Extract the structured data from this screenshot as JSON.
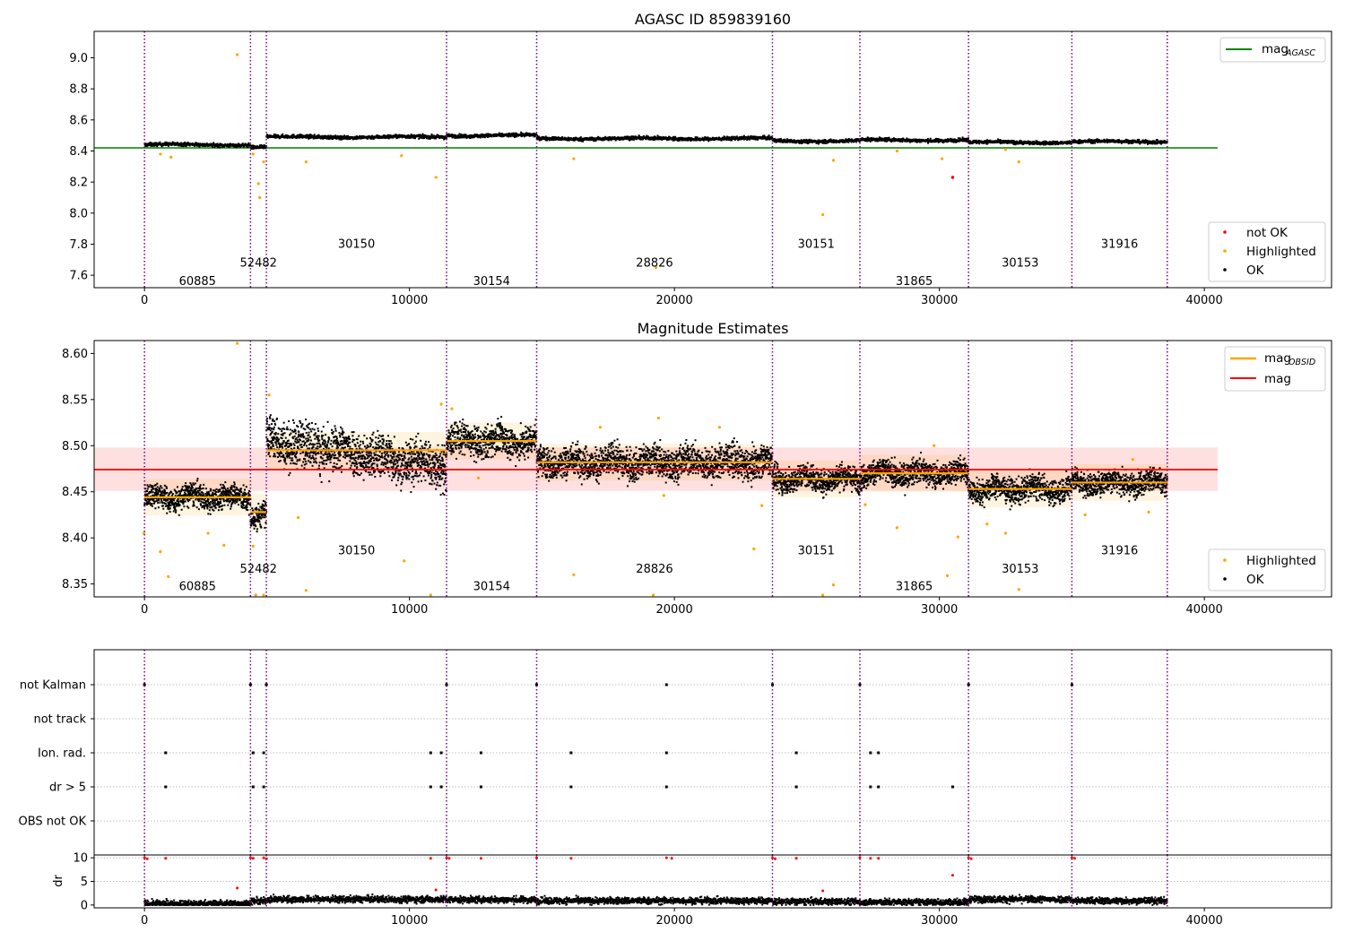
{
  "chart_data": [
    {
      "id": "p1",
      "type": "scatter",
      "title": "AGASC ID 859839160",
      "xlim": [
        -1900,
        44800
      ],
      "ylim": [
        7.52,
        9.17
      ],
      "xticks": [
        0,
        10000,
        20000,
        30000,
        40000
      ],
      "xtick_labels": [
        "0",
        "10000",
        "20000",
        "30000",
        "40000"
      ],
      "yticks": [
        7.6,
        7.8,
        8.0,
        8.2,
        8.4,
        8.6,
        8.8,
        9.0
      ],
      "ytick_labels": [
        "7.6",
        "7.8",
        "8.0",
        "8.2",
        "8.4",
        "8.6",
        "8.8",
        "9.0"
      ],
      "hline": {
        "name": "mag",
        "subscript": "AGASC",
        "y": 8.42,
        "x": [
          -1900,
          40500
        ],
        "color": "#008000"
      },
      "segments": [
        {
          "obsid": "60885",
          "x0": 0,
          "x1": 4000,
          "y": 8.44,
          "label_y": 7.56
        },
        {
          "obsid": "52482",
          "x0": 4000,
          "x1": 4600,
          "y": 8.425,
          "label_y": 7.68
        },
        {
          "obsid": "30150",
          "x0": 4600,
          "x1": 11400,
          "y": 8.49,
          "label_y": 7.8
        },
        {
          "obsid": "30154",
          "x0": 11400,
          "x1": 14800,
          "y": 8.5,
          "label_y": 7.56
        },
        {
          "obsid": "28826",
          "x0": 14800,
          "x1": 23700,
          "y": 8.48,
          "label_y": 7.68
        },
        {
          "obsid": "30151",
          "x0": 23700,
          "x1": 27000,
          "y": 8.465,
          "label_y": 7.8
        },
        {
          "obsid": "31865",
          "x0": 27000,
          "x1": 31100,
          "y": 8.47,
          "label_y": 7.56
        },
        {
          "obsid": "30153",
          "x0": 31100,
          "x1": 35000,
          "y": 8.455,
          "label_y": 7.68
        },
        {
          "obsid": "31916",
          "x0": 35000,
          "x1": 38600,
          "y": 8.46,
          "label_y": 7.8
        }
      ],
      "obs_boundaries": [
        0,
        4000,
        4600,
        11400,
        14800,
        23700,
        27000,
        31100,
        35000,
        38600
      ],
      "highlighted_points": [
        [
          3500,
          9.02
        ],
        [
          600,
          8.38
        ],
        [
          1000,
          8.36
        ],
        [
          4100,
          8.38
        ],
        [
          4300,
          8.19
        ],
        [
          4350,
          8.1
        ],
        [
          4500,
          8.33
        ],
        [
          6100,
          8.33
        ],
        [
          9700,
          8.37
        ],
        [
          11000,
          8.23
        ],
        [
          16200,
          8.35
        ],
        [
          19300,
          7.65
        ],
        [
          25600,
          7.99
        ],
        [
          26000,
          8.34
        ],
        [
          28400,
          8.4
        ],
        [
          30100,
          8.35
        ],
        [
          32500,
          8.41
        ],
        [
          33000,
          8.33
        ]
      ],
      "not_ok_points": [
        [
          30500,
          8.23
        ]
      ],
      "legend": [
        {
          "label": "mag",
          "subscript": "AGASC",
          "color": "#008000",
          "kind": "line"
        }
      ],
      "legend2": [
        {
          "label": "not OK",
          "color": "#ff0000",
          "kind": "dot"
        },
        {
          "label": "Highlighted",
          "color": "#ffa500",
          "kind": "dot"
        },
        {
          "label": "OK",
          "color": "#000000",
          "kind": "dot"
        }
      ]
    },
    {
      "id": "p2",
      "type": "scatter",
      "title": "Magnitude Estimates",
      "xlim": [
        -1900,
        44800
      ],
      "ylim": [
        8.336,
        8.614
      ],
      "xticks": [
        0,
        10000,
        20000,
        30000,
        40000
      ],
      "xtick_labels": [
        "0",
        "10000",
        "20000",
        "30000",
        "40000"
      ],
      "yticks": [
        8.35,
        8.4,
        8.45,
        8.5,
        8.55,
        8.6
      ],
      "ytick_labels": [
        "8.35",
        "8.40",
        "8.45",
        "8.50",
        "8.55",
        "8.60"
      ],
      "mag": {
        "name": "mag",
        "y": 8.474,
        "band": [
          8.451,
          8.498
        ],
        "x": [
          -1900,
          40500
        ],
        "color": "#ff0000"
      },
      "segments": [
        {
          "obsid": "60885",
          "x0": 0,
          "x1": 4000,
          "y": 8.444,
          "label_y": 8.347
        },
        {
          "obsid": "52482",
          "x0": 4000,
          "x1": 4600,
          "y": 8.428,
          "label_y": 8.366
        },
        {
          "obsid": "30150",
          "x0": 4600,
          "x1": 11400,
          "y": 8.495,
          "label_y": 8.386
        },
        {
          "obsid": "30154",
          "x0": 11400,
          "x1": 14800,
          "y": 8.505,
          "label_y": 8.347
        },
        {
          "obsid": "28826",
          "x0": 14800,
          "x1": 23700,
          "y": 8.482,
          "label_y": 8.366
        },
        {
          "obsid": "30151",
          "x0": 23700,
          "x1": 27000,
          "y": 8.464,
          "label_y": 8.386
        },
        {
          "obsid": "31865",
          "x0": 27000,
          "x1": 31100,
          "y": 8.47,
          "label_y": 8.347
        },
        {
          "obsid": "30153",
          "x0": 31100,
          "x1": 35000,
          "y": 8.453,
          "label_y": 8.366
        },
        {
          "obsid": "31916",
          "x0": 35000,
          "x1": 38600,
          "y": 8.46,
          "label_y": 8.386
        }
      ],
      "obs_boundaries": [
        0,
        4000,
        4600,
        11400,
        14800,
        23700,
        27000,
        31100,
        35000,
        38600
      ],
      "highlighted_points": [
        [
          3500,
          8.611
        ],
        [
          -20,
          8.405
        ],
        [
          600,
          8.385
        ],
        [
          900,
          8.358
        ],
        [
          2400,
          8.405
        ],
        [
          3000,
          8.392
        ],
        [
          4100,
          8.391
        ],
        [
          4200,
          8.338
        ],
        [
          4500,
          8.338
        ],
        [
          4700,
          8.555
        ],
        [
          5800,
          8.422
        ],
        [
          6100,
          8.343
        ],
        [
          9800,
          8.375
        ],
        [
          10800,
          8.338
        ],
        [
          11200,
          8.545
        ],
        [
          11600,
          8.54
        ],
        [
          12600,
          8.465
        ],
        [
          16200,
          8.36
        ],
        [
          17200,
          8.52
        ],
        [
          19200,
          8.338
        ],
        [
          19400,
          8.53
        ],
        [
          19600,
          8.446
        ],
        [
          21700,
          8.52
        ],
        [
          23000,
          8.388
        ],
        [
          23300,
          8.435
        ],
        [
          25600,
          8.338
        ],
        [
          26000,
          8.349
        ],
        [
          27200,
          8.436
        ],
        [
          28400,
          8.411
        ],
        [
          29800,
          8.5
        ],
        [
          30300,
          8.359
        ],
        [
          30700,
          8.401
        ],
        [
          31800,
          8.415
        ],
        [
          32500,
          8.405
        ],
        [
          33000,
          8.344
        ],
        [
          35500,
          8.425
        ],
        [
          37300,
          8.485
        ],
        [
          37900,
          8.428
        ]
      ],
      "legend": [
        {
          "label": "mag",
          "subscript": "OBSID",
          "color": "#ffa500",
          "kind": "line"
        },
        {
          "label": "mag",
          "color": "#ff0000",
          "kind": "line"
        }
      ],
      "legend2": [
        {
          "label": "Highlighted",
          "color": "#ffa500",
          "kind": "dot"
        },
        {
          "label": "OK",
          "color": "#000000",
          "kind": "dot"
        }
      ]
    },
    {
      "id": "p3",
      "type": "scatter",
      "title": "",
      "xlim": [
        -1900,
        44800
      ],
      "yticks_labels": [
        "not Kalman",
        "not track",
        "Ion. rad.",
        "dr > 5",
        "OBS not OK"
      ],
      "obs_boundaries": [
        0,
        4000,
        4600,
        11400,
        14800,
        23700,
        27000,
        31100,
        35000,
        38600
      ],
      "flags": {
        "not Kalman": [
          0,
          4000,
          4600,
          11400,
          14800,
          19700,
          23700,
          27000,
          31100,
          35000
        ],
        "not track": [],
        "Ion. rad.": [
          800,
          4100,
          4500,
          10800,
          11200,
          12700,
          16100,
          19700,
          24600,
          27400,
          27700
        ],
        "dr > 5": [
          800,
          4100,
          4500,
          10800,
          11200,
          12700,
          16100,
          19700,
          24600,
          27400,
          27700,
          30500
        ],
        "OBS not OK": []
      }
    },
    {
      "id": "p4",
      "type": "scatter",
      "title": "",
      "ylabel": "dr",
      "xlim": [
        -1900,
        44800
      ],
      "ylim": [
        -0.6,
        10.6
      ],
      "xticks": [
        0,
        10000,
        20000,
        30000,
        40000
      ],
      "xtick_labels": [
        "0",
        "10000",
        "20000",
        "30000",
        "40000"
      ],
      "yticks": [
        0,
        5,
        10
      ],
      "ytick_labels": [
        "0",
        "5",
        "10"
      ],
      "obs_boundaries": [
        0,
        4000,
        4600,
        11400,
        14800,
        23700,
        27000,
        31100,
        35000,
        38600
      ],
      "segments": [
        {
          "x0": 0,
          "x1": 4000,
          "y": 0.3
        },
        {
          "x0": 4000,
          "x1": 4600,
          "y": 0.8
        },
        {
          "x0": 4600,
          "x1": 11400,
          "y": 1.2
        },
        {
          "x0": 11400,
          "x1": 14800,
          "y": 1.1
        },
        {
          "x0": 14800,
          "x1": 23700,
          "y": 0.9
        },
        {
          "x0": 23700,
          "x1": 27000,
          "y": 0.7
        },
        {
          "x0": 27000,
          "x1": 31100,
          "y": 0.6
        },
        {
          "x0": 31100,
          "x1": 35000,
          "y": 1.2
        },
        {
          "x0": 35000,
          "x1": 38600,
          "y": 0.9
        }
      ],
      "red_points": [
        [
          0,
          10
        ],
        [
          100,
          9.8
        ],
        [
          800,
          9.9
        ],
        [
          4000,
          10
        ],
        [
          4100,
          9.9
        ],
        [
          4500,
          10
        ],
        [
          4600,
          9.8
        ],
        [
          10800,
          9.9
        ],
        [
          11400,
          10
        ],
        [
          11500,
          9.9
        ],
        [
          12700,
          9.9
        ],
        [
          14800,
          10
        ],
        [
          16100,
          9.9
        ],
        [
          19700,
          10
        ],
        [
          19900,
          9.9
        ],
        [
          23700,
          10
        ],
        [
          23800,
          9.8
        ],
        [
          24600,
          9.9
        ],
        [
          27000,
          10
        ],
        [
          27400,
          9.9
        ],
        [
          27700,
          9.9
        ],
        [
          31100,
          10
        ],
        [
          31200,
          9.8
        ],
        [
          35000,
          10
        ],
        [
          35100,
          9.9
        ],
        [
          30500,
          6.3
        ],
        [
          3500,
          3.6
        ],
        [
          25600,
          3.0
        ],
        [
          11000,
          3.2
        ]
      ]
    }
  ]
}
